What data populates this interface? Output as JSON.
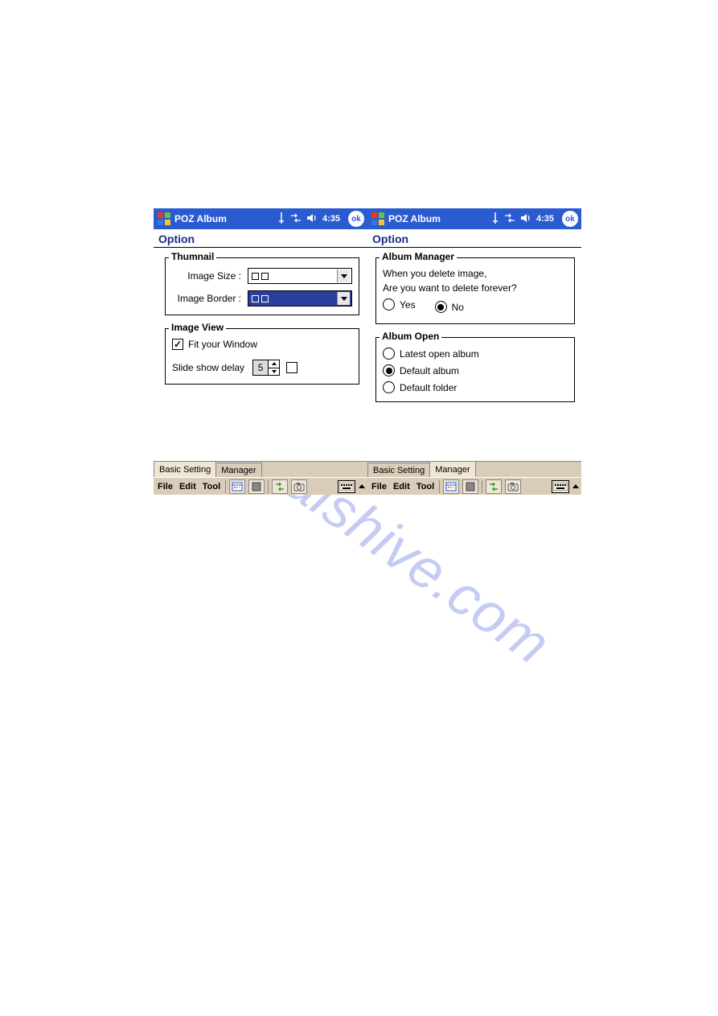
{
  "watermark": "manualshive.com",
  "titlebar": {
    "app": "POZ Album",
    "time": "4:35",
    "ok": "ok"
  },
  "left": {
    "header": "Option",
    "thumbnail": {
      "legend": "Thumnail",
      "imageSizeLabel": "Image Size :",
      "imageBorderLabel": "Image Border :"
    },
    "imageView": {
      "legend": "Image View",
      "fitLabel": "Fit your Window",
      "slideLabel": "Slide show delay",
      "slideValue": "5"
    },
    "tabs": {
      "basic": "Basic Setting",
      "manager": "Manager",
      "active": "basic"
    },
    "menu": {
      "file": "File",
      "edit": "Edit",
      "tool": "Tool"
    }
  },
  "right": {
    "header": "Option",
    "albumManager": {
      "legend": "Album Manager",
      "line1": "When you delete image,",
      "line2": "Are you want to delete forever?",
      "yes": "Yes",
      "no": "No",
      "selected": "no"
    },
    "albumOpen": {
      "legend": "Album Open",
      "opt1": "Latest open album",
      "opt2": "Default album",
      "opt3": "Default folder",
      "selected": "opt2"
    },
    "tabs": {
      "basic": "Basic Setting",
      "manager": "Manager",
      "active": "manager"
    },
    "menu": {
      "file": "File",
      "edit": "Edit",
      "tool": "Tool"
    }
  }
}
